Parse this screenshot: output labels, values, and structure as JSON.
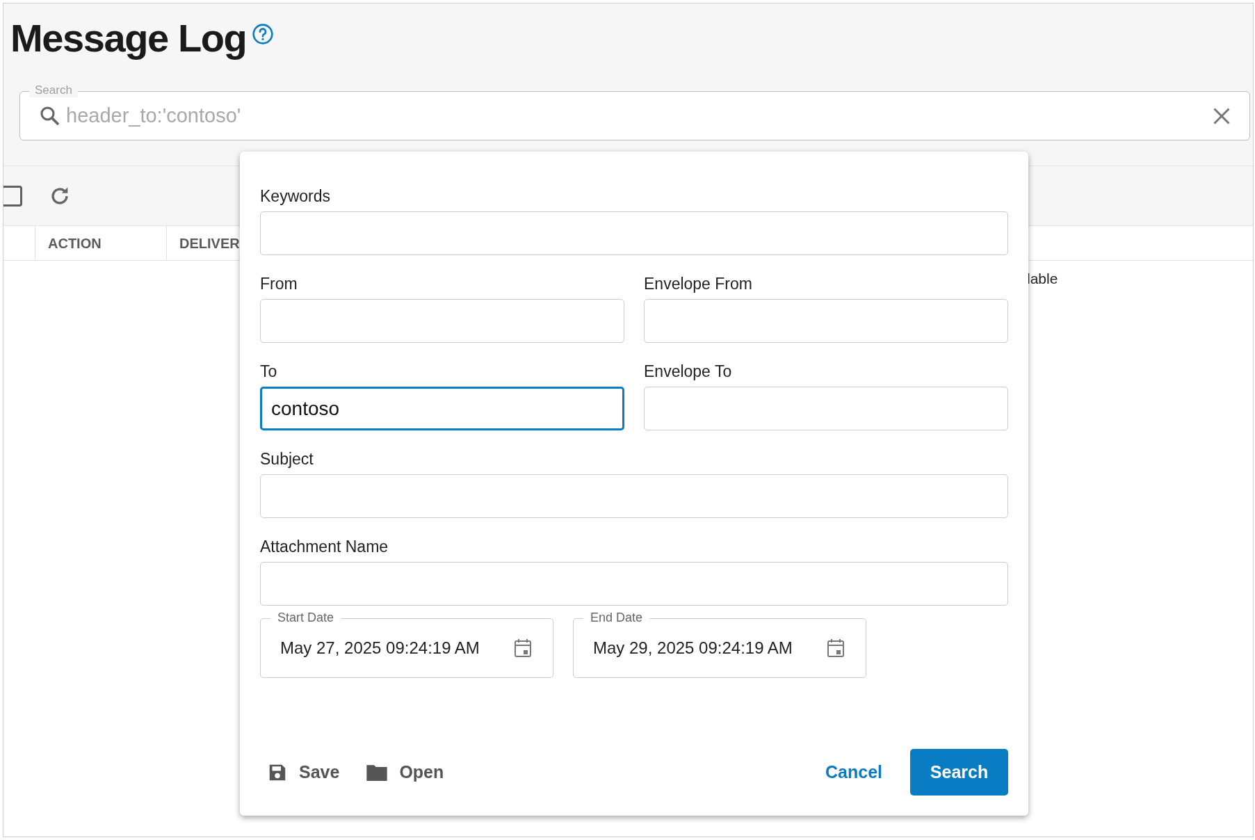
{
  "page": {
    "title": "Message Log"
  },
  "search": {
    "label": "Search",
    "placeholder": "header_to:'contoso'"
  },
  "toolbar": {
    "select_all_checked": false
  },
  "table": {
    "columns": [
      "ACTION",
      "DELIVER"
    ],
    "empty_text": "lable"
  },
  "dialog": {
    "fields": [
      {
        "label": "Keywords",
        "focused": false,
        "kind": "full"
      },
      {
        "label": "From",
        "focused": false,
        "kind": "half"
      },
      {
        "label": "Envelope From",
        "focused": false,
        "kind": "half"
      },
      {
        "label": "To",
        "value": "contoso",
        "focused": true,
        "kind": "half"
      },
      {
        "label": "Envelope To",
        "focused": false,
        "kind": "half"
      },
      {
        "label": "Subject",
        "focused": false,
        "kind": "full"
      },
      {
        "label": "Attachment Name",
        "focused": false,
        "kind": "full"
      }
    ],
    "dates": [
      {
        "label": "Start Date",
        "value": "May 27, 2025 09:24:19 AM"
      },
      {
        "label": "End Date",
        "value": "May 29, 2025 09:24:19 AM"
      }
    ],
    "buttons": [
      {
        "kind": "save",
        "label": "Save"
      },
      {
        "kind": "open",
        "label": "Open"
      },
      {
        "kind": "cancel",
        "label": "Cancel"
      },
      {
        "kind": "search",
        "label": "Search"
      }
    ]
  }
}
